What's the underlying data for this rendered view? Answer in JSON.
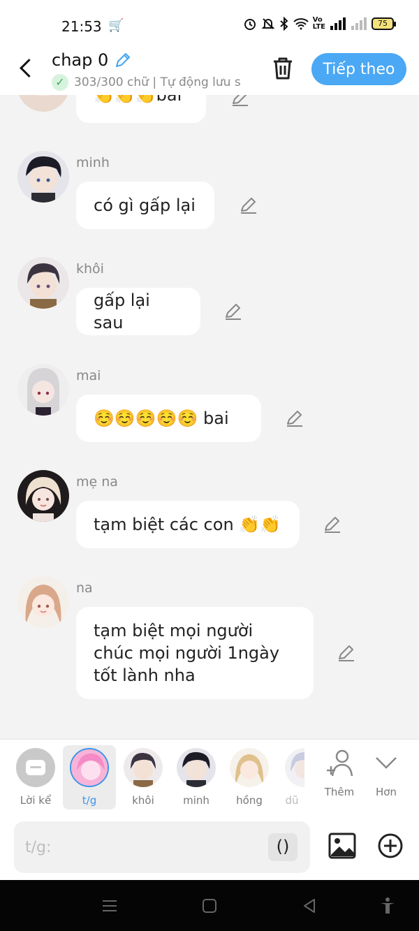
{
  "status_bar": {
    "time": "21:53",
    "battery": "75",
    "volte": "Vo\nLTE"
  },
  "header": {
    "title": "chap 0",
    "subtitle": "303/300 chữ | Tự động lưu s",
    "next_label": "Tiếp theo"
  },
  "messages": [
    {
      "name": "",
      "text": "👏👏👏bai"
    },
    {
      "name": "minh",
      "text": "có gì gấp lại"
    },
    {
      "name": "khôi",
      "text": "gấp lại sau"
    },
    {
      "name": "mai",
      "text": "☺️☺️☺️☺️☺️ bai"
    },
    {
      "name": "mẹ na",
      "text": "tạm biệt các con 👏👏"
    },
    {
      "name": "na",
      "text": "tạm biệt mọi người chúc mọi người 1ngày tốt lành nha"
    }
  ],
  "character_bar": {
    "items": [
      {
        "label": "Lời kể"
      },
      {
        "label": "t/g"
      },
      {
        "label": "khôi"
      },
      {
        "label": "minh"
      },
      {
        "label": "hồng"
      },
      {
        "label": "dũ"
      }
    ],
    "more_label": "Thêm",
    "collapse_label": "Hơn"
  },
  "input": {
    "placeholder": "t/g:",
    "paren_label": "()"
  },
  "colors": {
    "accent": "#4aa8f4",
    "selected": "#3d93e8",
    "background": "#f3f3f3"
  }
}
